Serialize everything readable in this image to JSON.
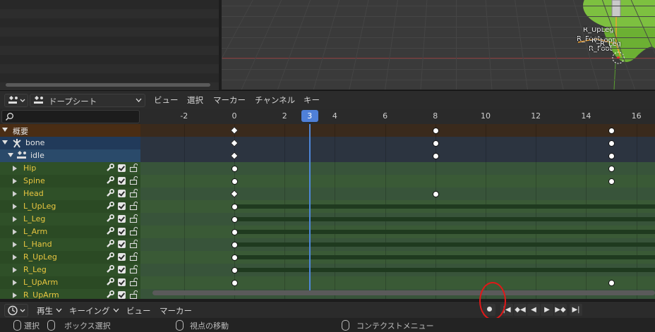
{
  "viewport": {
    "bone_labels": [
      "R_UpLeg",
      "R_Foot",
      "R_Foot",
      "R_Leg",
      "R_Foot"
    ]
  },
  "header": {
    "editor_type": "ドープシート",
    "menus": [
      "ビュー",
      "選択",
      "マーカー",
      "チャンネル",
      "キー"
    ]
  },
  "ruler": {
    "ticks": [
      "-2",
      "0",
      "2",
      "4",
      "6",
      "8",
      "10",
      "12",
      "14",
      "16"
    ],
    "current_frame": "3"
  },
  "channels": [
    {
      "label": "概要",
      "kind": "summary"
    },
    {
      "label": "bone",
      "kind": "object"
    },
    {
      "label": "idle",
      "kind": "action"
    },
    {
      "label": "Hip",
      "kind": "bone"
    },
    {
      "label": "Spine",
      "kind": "bone"
    },
    {
      "label": "Head",
      "kind": "bone"
    },
    {
      "label": "L_UpLeg",
      "kind": "bone"
    },
    {
      "label": "L_Leg",
      "kind": "bone"
    },
    {
      "label": "L_Arm",
      "kind": "bone"
    },
    {
      "label": "L_Hand",
      "kind": "bone"
    },
    {
      "label": "R_UpLeg",
      "kind": "bone"
    },
    {
      "label": "R_Leg",
      "kind": "bone"
    },
    {
      "label": "L_UpArm",
      "kind": "bone"
    },
    {
      "label": "R_UpArm",
      "kind": "bone"
    }
  ],
  "keyframes": [
    {
      "row": 0,
      "frames": [
        0,
        8,
        15
      ],
      "diamond_at": [
        0
      ]
    },
    {
      "row": 1,
      "frames": [
        0,
        8,
        15
      ],
      "diamond_at": [
        0
      ]
    },
    {
      "row": 2,
      "frames": [
        0,
        8,
        15
      ],
      "diamond_at": [
        0
      ]
    },
    {
      "row": 3,
      "frames": [
        0,
        15
      ],
      "diamond_at": []
    },
    {
      "row": 4,
      "frames": [
        0,
        15
      ],
      "diamond_at": []
    },
    {
      "row": 5,
      "frames": [
        0,
        8
      ],
      "diamond_at": [
        0
      ]
    },
    {
      "row": 6,
      "frames": [
        0
      ],
      "diamond_at": [],
      "hold": true
    },
    {
      "row": 7,
      "frames": [
        0
      ],
      "diamond_at": [],
      "hold": true
    },
    {
      "row": 8,
      "frames": [
        0
      ],
      "diamond_at": [],
      "hold": true
    },
    {
      "row": 9,
      "frames": [
        0
      ],
      "diamond_at": [],
      "hold": true
    },
    {
      "row": 10,
      "frames": [
        0
      ],
      "diamond_at": [],
      "hold": true
    },
    {
      "row": 11,
      "frames": [
        0
      ],
      "diamond_at": [],
      "hold": true
    },
    {
      "row": 12,
      "frames": [
        0,
        15
      ],
      "diamond_at": []
    }
  ],
  "timeline": {
    "playback": "再生",
    "keying": "キーイング",
    "view": "ビュー",
    "marker": "マーカー"
  },
  "status": {
    "select": "選択",
    "box_select": "ボックス選択",
    "pan_view": "視点の移動",
    "context_menu": "コンテクストメニュー"
  },
  "colors": {
    "summary_row": "#4a2d14",
    "object_row": "#213a5a",
    "action_row": "#2a4a6a",
    "bone_row": "#355a2a",
    "bone_label": "#e8c640",
    "playhead": "#4f80d8",
    "annotation": "#e01818"
  }
}
